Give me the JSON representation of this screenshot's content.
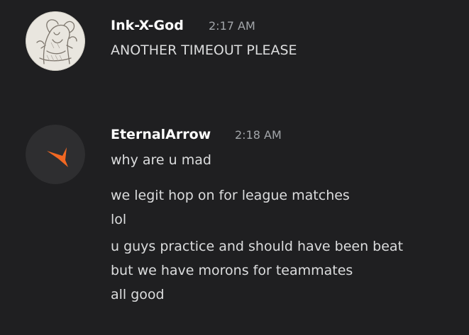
{
  "messages": [
    {
      "author": "Ink-X-God",
      "timestamp": "2:17 AM",
      "avatar_icon": "sketch-drawing-avatar",
      "lines": [
        "ANOTHER TIMEOUT PLEASE"
      ]
    },
    {
      "author": "EternalArrow",
      "timestamp": "2:18 AM",
      "avatar_icon": "orange-arrow-avatar",
      "accent_color": "#f26822",
      "lines": [
        "why are u mad",
        "we legit hop on for league matches",
        "lol",
        "u guys practice and should have been beat",
        "but we have morons for teammates",
        "all good"
      ]
    }
  ]
}
